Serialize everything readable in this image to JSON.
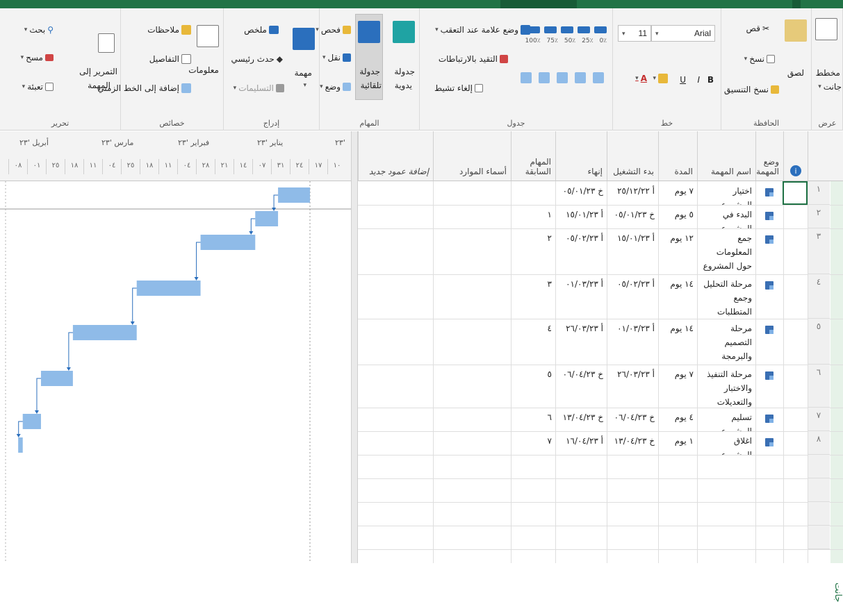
{
  "ribbon": {
    "groups": {
      "view": "عرض",
      "clipboard": "الحافظة",
      "font": "خط",
      "schedule": "جدول",
      "tasks": "المهام",
      "insert": "إدراج",
      "properties": "خصائص",
      "editing": "تحرير"
    },
    "view": {
      "gantt_chart": "مخطط",
      "gantt_chart_2": "جانت"
    },
    "clipboard": {
      "paste": "لصق",
      "cut": "قص",
      "copy": "نسخ",
      "format_painter": "نسخ التنسيق"
    },
    "font": {
      "name": "Arial",
      "size": "11",
      "bold": "B",
      "italic": "I",
      "underline": "U",
      "color_a": "A"
    },
    "schedule": {
      "mark_on_track": "وضع علامة عند التعقب",
      "respect_links": "التقيد بالارتباطات",
      "inactivate": "إلغاء تشيط",
      "percent": [
        "100٪",
        "75٪",
        "50٪",
        "25٪",
        "0٪"
      ]
    },
    "tasks": {
      "manually": "جدولة",
      "manually_2": "يدوية",
      "auto": "جدولة",
      "auto_2": "تلقائية",
      "inspect": "فحص",
      "move": "نقل",
      "mode": "وضع"
    },
    "insert": {
      "summary": "ملخص",
      "milestone": "حدث رئيسي",
      "deliverable": "التسليمات",
      "task": "مهمة"
    },
    "properties": {
      "notes": "ملاحظات",
      "details": "التفاصيل",
      "add_timeline": "إضافة إلى الخط الزمني",
      "information": "معلومات"
    },
    "editing": {
      "find": "بحث",
      "clear": "مسح",
      "fill": "تعبئة",
      "scroll": "التمرير إلى",
      "scroll_2": "المهمة"
    }
  },
  "timescale": {
    "months": [
      "أبريل '٢٣",
      "مارس '٢٣",
      "فبراير '٢٣",
      "يناير '٢٣",
      "٢٣'"
    ],
    "days": [
      "٠٨",
      "٠١",
      "٢٥",
      "١٨",
      "١١",
      "٠٤",
      "٢٥",
      "١٨",
      "١١",
      "٠٤",
      "٢٨",
      "٢١",
      "١٤",
      "٠٧",
      "٣١",
      "٢٤",
      "١٧",
      "١٠"
    ]
  },
  "table": {
    "headers": {
      "info": "ℹ",
      "mode": "وضع المهمة",
      "name": "اسم المهمة",
      "duration": "المدة",
      "start": "بدء التشغيل",
      "finish": "إنهاء",
      "pred": "المهام السابقة",
      "resources": "أسماء الموارد",
      "add_column": "إضافة عمود جديد"
    },
    "rows": [
      {
        "num": "١",
        "name": "اختيار المشروع",
        "duration": "٧ يوم",
        "start": "أ ٢٥/١٢/٢٢",
        "finish": "خ ٠٥/٠١/٢٣",
        "pred": ""
      },
      {
        "num": "٢",
        "name": "البدء في المشروع",
        "duration": "٥ يوم",
        "start": "خ ٠٥/٠١/٢٣",
        "finish": "أ ١٥/٠١/٢٣",
        "pred": "١"
      },
      {
        "num": "٣",
        "name": "جمع المعلومات حول المشروع",
        "duration": "١٢ يوم",
        "start": "أ ١٥/٠١/٢٣",
        "finish": "أ ٠٥/٠٢/٢٣",
        "pred": "٢"
      },
      {
        "num": "٤",
        "name": "مرحلة التحليل وجمع المتطلبات",
        "duration": "١٤ يوم",
        "start": "أ ٠٥/٠٢/٢٣",
        "finish": "أ ٠١/٠٣/٢٣",
        "pred": "٣"
      },
      {
        "num": "٥",
        "name": "مرحلة التصميم والبرمجة",
        "duration": "١٤ يوم",
        "start": "أ ٠١/٠٣/٢٣",
        "finish": "أ ٢٦/٠٣/٢٣",
        "pred": "٤"
      },
      {
        "num": "٦",
        "name": "مرحلة التنفيذ والاختبار والتعديلات",
        "duration": "٧ يوم",
        "start": "أ ٢٦/٠٣/٢٣",
        "finish": "خ ٠٦/٠٤/٢٣",
        "pred": "٥"
      },
      {
        "num": "٧",
        "name": "تسليم المشروع",
        "duration": "٤ يوم",
        "start": "خ ٠٦/٠٤/٢٣",
        "finish": "خ ١٣/٠٤/٢٣",
        "pred": "٦"
      },
      {
        "num": "٨",
        "name": "اغلاق المشروع",
        "duration": "١ يوم",
        "start": "خ ١٣/٠٤/٢٣",
        "finish": "أ ١٦/٠٤/٢٣",
        "pred": "٧"
      }
    ]
  },
  "side_label": "مخطط جانت",
  "colors": {
    "accent": "#217346",
    "bar": "#8fbbe8",
    "arrow": "#2b6fbd"
  }
}
